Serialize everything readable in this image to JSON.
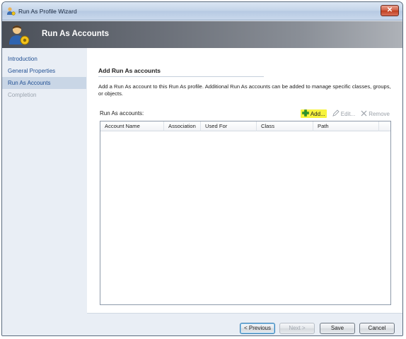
{
  "window": {
    "title": "Run As Profile Wizard",
    "close_label": "✕"
  },
  "banner": {
    "title": "Run As Accounts"
  },
  "nav": {
    "items": [
      {
        "label": "Introduction"
      },
      {
        "label": "General Properties"
      },
      {
        "label": "Run As Accounts",
        "state": "active"
      },
      {
        "label": "Completion",
        "state": "disabled"
      }
    ]
  },
  "main": {
    "section_title": "Add Run As accounts",
    "description": "Add a Run As account to this Run As profile.  Additional Run As accounts can be added to manage specific classes, groups, or objects.",
    "accounts_label": "Run As accounts:",
    "toolbar": {
      "add": "Add...",
      "edit": "Edit...",
      "remove": "Remove"
    },
    "table": {
      "columns": [
        "Account Name",
        "Association",
        "Used For",
        "Class",
        "Path"
      ],
      "rows": []
    }
  },
  "footer": {
    "previous": "< Previous",
    "next": "Next >",
    "save": "Save",
    "cancel": "Cancel"
  },
  "colors": {
    "highlight": "#f7f33d",
    "active_nav": "#c9d6e6",
    "link": "#1f4e92"
  }
}
